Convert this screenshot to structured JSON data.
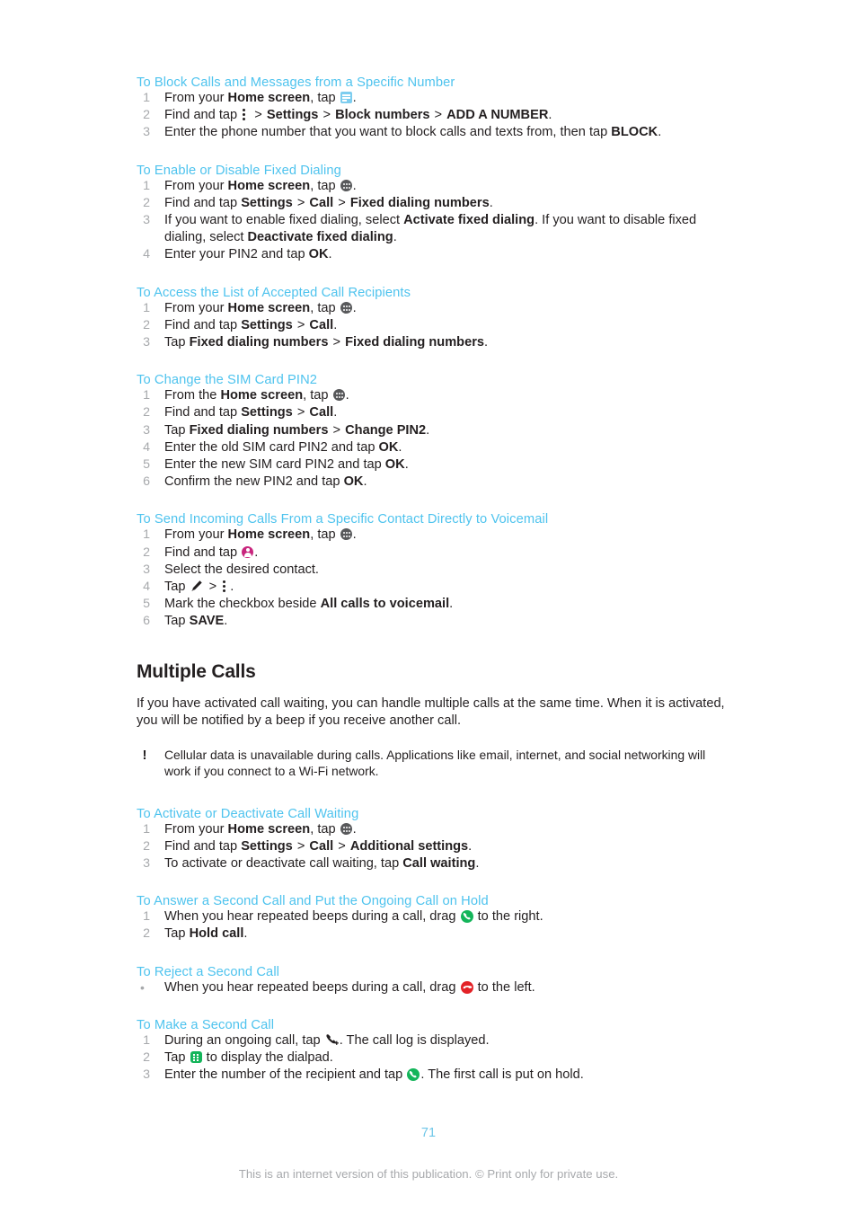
{
  "page": {
    "number": "71",
    "footer_note": "This is an internet version of this publication. © Print only for private use."
  },
  "colors": {
    "heading_blue": "#4ec3ee",
    "page_number_blue": "#6ec6e8",
    "body_text": "#231f20",
    "step_number_gray": "#a7a9ac",
    "footer_gray": "#a7a9ac",
    "answer_green": "#14b55a",
    "reject_red": "#e32227",
    "contacts_magenta": "#c8257d",
    "messaging_blue": "#7dcdef",
    "appdrawer_gray": "#58595b"
  },
  "procedures": [
    {
      "id": "block-calls-messages",
      "heading": "To Block Calls and Messages from a Specific Number",
      "steps": [
        {
          "num": "1",
          "parts": [
            {
              "t": "text",
              "v": "From your "
            },
            {
              "t": "bold",
              "v": "Home screen"
            },
            {
              "t": "text",
              "v": ", tap "
            },
            {
              "t": "icon",
              "v": "messaging-app-icon"
            },
            {
              "t": "text",
              "v": "."
            }
          ]
        },
        {
          "num": "2",
          "parts": [
            {
              "t": "text",
              "v": "Find and tap "
            },
            {
              "t": "icon",
              "v": "overflow-menu-icon"
            },
            {
              "t": "gt",
              "v": ">"
            },
            {
              "t": "bold",
              "v": "Settings"
            },
            {
              "t": "gt",
              "v": ">"
            },
            {
              "t": "bold",
              "v": "Block numbers"
            },
            {
              "t": "gt",
              "v": ">"
            },
            {
              "t": "bold",
              "v": "ADD A NUMBER"
            },
            {
              "t": "text",
              "v": "."
            }
          ]
        },
        {
          "num": "3",
          "parts": [
            {
              "t": "text",
              "v": "Enter the phone number that you want to block calls and texts from, then tap "
            },
            {
              "t": "bold",
              "v": "BLOCK"
            },
            {
              "t": "text",
              "v": "."
            }
          ]
        }
      ]
    },
    {
      "id": "enable-disable-fixed-dialing",
      "heading": "To Enable or Disable Fixed Dialing",
      "steps": [
        {
          "num": "1",
          "parts": [
            {
              "t": "text",
              "v": "From your "
            },
            {
              "t": "bold",
              "v": "Home screen"
            },
            {
              "t": "text",
              "v": ", tap "
            },
            {
              "t": "icon",
              "v": "app-drawer-icon"
            },
            {
              "t": "text",
              "v": "."
            }
          ]
        },
        {
          "num": "2",
          "parts": [
            {
              "t": "text",
              "v": "Find and tap "
            },
            {
              "t": "bold",
              "v": "Settings"
            },
            {
              "t": "gt",
              "v": ">"
            },
            {
              "t": "bold",
              "v": "Call"
            },
            {
              "t": "gt",
              "v": ">"
            },
            {
              "t": "bold",
              "v": "Fixed dialing numbers"
            },
            {
              "t": "text",
              "v": "."
            }
          ]
        },
        {
          "num": "3",
          "parts": [
            {
              "t": "text",
              "v": "If you want to enable fixed dialing, select "
            },
            {
              "t": "bold",
              "v": "Activate fixed dialing"
            },
            {
              "t": "text",
              "v": ". If you want to disable fixed dialing, select "
            },
            {
              "t": "bold",
              "v": "Deactivate fixed dialing"
            },
            {
              "t": "text",
              "v": "."
            }
          ]
        },
        {
          "num": "4",
          "parts": [
            {
              "t": "text",
              "v": "Enter your PIN2 and tap "
            },
            {
              "t": "bold",
              "v": "OK"
            },
            {
              "t": "text",
              "v": "."
            }
          ]
        }
      ]
    },
    {
      "id": "access-accepted-call-recipients",
      "heading": "To Access the List of Accepted Call Recipients",
      "steps": [
        {
          "num": "1",
          "parts": [
            {
              "t": "text",
              "v": "From your "
            },
            {
              "t": "bold",
              "v": "Home screen"
            },
            {
              "t": "text",
              "v": ", tap "
            },
            {
              "t": "icon",
              "v": "app-drawer-icon"
            },
            {
              "t": "text",
              "v": "."
            }
          ]
        },
        {
          "num": "2",
          "parts": [
            {
              "t": "text",
              "v": "Find and tap "
            },
            {
              "t": "bold",
              "v": "Settings"
            },
            {
              "t": "gt",
              "v": ">"
            },
            {
              "t": "bold",
              "v": "Call"
            },
            {
              "t": "text",
              "v": "."
            }
          ]
        },
        {
          "num": "3",
          "parts": [
            {
              "t": "text",
              "v": "Tap "
            },
            {
              "t": "bold",
              "v": "Fixed dialing numbers"
            },
            {
              "t": "gt",
              "v": ">"
            },
            {
              "t": "bold",
              "v": "Fixed dialing numbers"
            },
            {
              "t": "text",
              "v": "."
            }
          ]
        }
      ]
    },
    {
      "id": "change-sim-card-pin2",
      "heading": "To Change the SIM Card PIN2",
      "steps": [
        {
          "num": "1",
          "parts": [
            {
              "t": "text",
              "v": "From the "
            },
            {
              "t": "bold",
              "v": "Home screen"
            },
            {
              "t": "text",
              "v": ", tap "
            },
            {
              "t": "icon",
              "v": "app-drawer-icon"
            },
            {
              "t": "text",
              "v": "."
            }
          ]
        },
        {
          "num": "2",
          "parts": [
            {
              "t": "text",
              "v": "Find and tap "
            },
            {
              "t": "bold",
              "v": "Settings"
            },
            {
              "t": "gt",
              "v": ">"
            },
            {
              "t": "bold",
              "v": "Call"
            },
            {
              "t": "text",
              "v": "."
            }
          ]
        },
        {
          "num": "3",
          "parts": [
            {
              "t": "text",
              "v": "Tap "
            },
            {
              "t": "bold",
              "v": "Fixed dialing numbers"
            },
            {
              "t": "gt",
              "v": ">"
            },
            {
              "t": "bold",
              "v": "Change PIN2"
            },
            {
              "t": "text",
              "v": "."
            }
          ]
        },
        {
          "num": "4",
          "parts": [
            {
              "t": "text",
              "v": "Enter the old SIM card PIN2 and tap "
            },
            {
              "t": "bold",
              "v": "OK"
            },
            {
              "t": "text",
              "v": "."
            }
          ]
        },
        {
          "num": "5",
          "parts": [
            {
              "t": "text",
              "v": "Enter the new SIM card PIN2 and tap "
            },
            {
              "t": "bold",
              "v": "OK"
            },
            {
              "t": "text",
              "v": "."
            }
          ]
        },
        {
          "num": "6",
          "parts": [
            {
              "t": "text",
              "v": "Confirm the new PIN2 and tap "
            },
            {
              "t": "bold",
              "v": "OK"
            },
            {
              "t": "text",
              "v": "."
            }
          ]
        }
      ]
    },
    {
      "id": "send-incoming-calls-to-voicemail",
      "heading": "To Send Incoming Calls From a Specific Contact Directly to Voicemail",
      "steps": [
        {
          "num": "1",
          "parts": [
            {
              "t": "text",
              "v": "From your "
            },
            {
              "t": "bold",
              "v": "Home screen"
            },
            {
              "t": "text",
              "v": ", tap "
            },
            {
              "t": "icon",
              "v": "app-drawer-icon"
            },
            {
              "t": "text",
              "v": "."
            }
          ]
        },
        {
          "num": "2",
          "parts": [
            {
              "t": "text",
              "v": "Find and tap "
            },
            {
              "t": "icon",
              "v": "contacts-icon"
            },
            {
              "t": "text",
              "v": "."
            }
          ]
        },
        {
          "num": "3",
          "parts": [
            {
              "t": "text",
              "v": "Select the desired contact."
            }
          ]
        },
        {
          "num": "4",
          "parts": [
            {
              "t": "text",
              "v": "Tap "
            },
            {
              "t": "icon",
              "v": "edit-pencil-icon"
            },
            {
              "t": "gt",
              "v": ">"
            },
            {
              "t": "icon",
              "v": "overflow-menu-icon"
            },
            {
              "t": "text",
              "v": "."
            }
          ]
        },
        {
          "num": "5",
          "parts": [
            {
              "t": "text",
              "v": "Mark the checkbox beside "
            },
            {
              "t": "bold",
              "v": "All calls to voicemail"
            },
            {
              "t": "text",
              "v": "."
            }
          ]
        },
        {
          "num": "6",
          "parts": [
            {
              "t": "text",
              "v": "Tap "
            },
            {
              "t": "bold",
              "v": "SAVE"
            },
            {
              "t": "text",
              "v": "."
            }
          ]
        }
      ]
    }
  ],
  "multiple_calls": {
    "title": "Multiple Calls",
    "intro": "If you have activated call waiting, you can handle multiple calls at the same time. When it is activated, you will be notified by a beep if you receive another call.",
    "note_icon": "exclamation-icon",
    "note": "Cellular data is unavailable during calls. Applications like email, internet, and social networking will work if you connect to a Wi-Fi network."
  },
  "procedures2": [
    {
      "id": "activate-deactivate-call-waiting",
      "heading": "To Activate or Deactivate Call Waiting",
      "steps": [
        {
          "num": "1",
          "parts": [
            {
              "t": "text",
              "v": "From your "
            },
            {
              "t": "bold",
              "v": "Home screen"
            },
            {
              "t": "text",
              "v": ", tap "
            },
            {
              "t": "icon",
              "v": "app-drawer-icon"
            },
            {
              "t": "text",
              "v": "."
            }
          ]
        },
        {
          "num": "2",
          "parts": [
            {
              "t": "text",
              "v": "Find and tap "
            },
            {
              "t": "bold",
              "v": "Settings"
            },
            {
              "t": "gt",
              "v": ">"
            },
            {
              "t": "bold",
              "v": "Call"
            },
            {
              "t": "gt",
              "v": ">"
            },
            {
              "t": "bold",
              "v": "Additional settings"
            },
            {
              "t": "text",
              "v": "."
            }
          ]
        },
        {
          "num": "3",
          "parts": [
            {
              "t": "text",
              "v": "To activate or deactivate call waiting, tap "
            },
            {
              "t": "bold",
              "v": "Call waiting"
            },
            {
              "t": "text",
              "v": "."
            }
          ]
        }
      ]
    },
    {
      "id": "answer-second-call-hold",
      "heading": "To Answer a Second Call and Put the Ongoing Call on Hold",
      "steps": [
        {
          "num": "1",
          "parts": [
            {
              "t": "text",
              "v": "When you hear repeated beeps during a call, drag "
            },
            {
              "t": "icon",
              "v": "answer-call-icon"
            },
            {
              "t": "text",
              "v": " to the right."
            }
          ]
        },
        {
          "num": "2",
          "parts": [
            {
              "t": "text",
              "v": "Tap "
            },
            {
              "t": "bold",
              "v": "Hold call"
            },
            {
              "t": "text",
              "v": "."
            }
          ]
        }
      ]
    },
    {
      "id": "reject-second-call",
      "heading": "To Reject a Second Call",
      "bulleted": true,
      "steps": [
        {
          "num": "•",
          "parts": [
            {
              "t": "text",
              "v": "When you hear repeated beeps during a call, drag "
            },
            {
              "t": "icon",
              "v": "reject-call-icon"
            },
            {
              "t": "text",
              "v": " to the left."
            }
          ]
        }
      ]
    },
    {
      "id": "make-second-call",
      "heading": "To Make a Second Call",
      "steps": [
        {
          "num": "1",
          "parts": [
            {
              "t": "text",
              "v": "During an ongoing call, tap "
            },
            {
              "t": "icon",
              "v": "add-call-icon"
            },
            {
              "t": "text",
              "v": ". The call log is displayed."
            }
          ]
        },
        {
          "num": "2",
          "parts": [
            {
              "t": "text",
              "v": "Tap "
            },
            {
              "t": "icon",
              "v": "dialpad-icon"
            },
            {
              "t": "text",
              "v": " to display the dialpad."
            }
          ]
        },
        {
          "num": "3",
          "parts": [
            {
              "t": "text",
              "v": "Enter the number of the recipient and tap "
            },
            {
              "t": "icon",
              "v": "answer-call-icon"
            },
            {
              "t": "text",
              "v": ". The first call is put on hold."
            }
          ]
        }
      ]
    }
  ]
}
